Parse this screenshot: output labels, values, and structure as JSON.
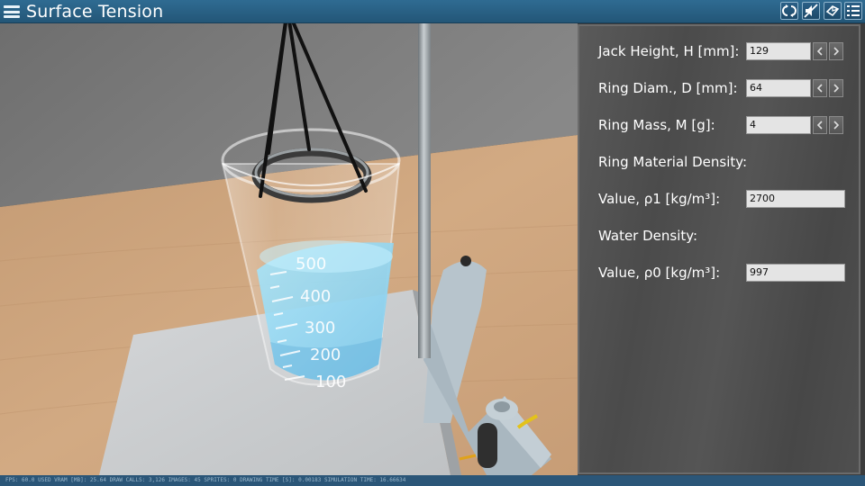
{
  "app": {
    "title": "Surface Tension"
  },
  "toolbar": {
    "buttons": [
      {
        "name": "reset-view-button",
        "icon": "reset-arrows-icon"
      },
      {
        "name": "sound-toggle-button",
        "icon": "mute-icon"
      },
      {
        "name": "camera-view-button",
        "icon": "cube-view-icon"
      },
      {
        "name": "property-list-button",
        "icon": "list-icon"
      }
    ]
  },
  "panel": {
    "jack_height": {
      "label": "Jack Height, H [mm]:",
      "value": "129"
    },
    "ring_diameter": {
      "label": "Ring Diam., D [mm]:",
      "value": "64"
    },
    "ring_mass": {
      "label": "Ring Mass, M [g]:",
      "value": "4"
    },
    "ring_density_heading": "Ring Material Density:",
    "ring_density": {
      "label": "Value, ρ1 [kg/m³]:",
      "value": "2700"
    },
    "water_density_heading": "Water Density:",
    "water_density": {
      "label": "Value, ρ0 [kg/m³]:",
      "value": "997"
    }
  },
  "scene": {
    "beaker_graduations": [
      "500",
      "400",
      "300",
      "200",
      "100"
    ],
    "colors": {
      "title_bar": "#2a6188",
      "water": "#8fd6f2",
      "table": "#c9a07a",
      "wall": "#7a7a7a",
      "panel": "#4f4f4f"
    }
  },
  "status": {
    "text": "FPS: 60.0 USED VRAM [MB]: 25.64 DRAW CALLS: 3,126 IMAGES: 45 SPRITES: 0 DRAWING TIME [S]: 0.00183 SIMULATION TIME: 16.66634"
  }
}
